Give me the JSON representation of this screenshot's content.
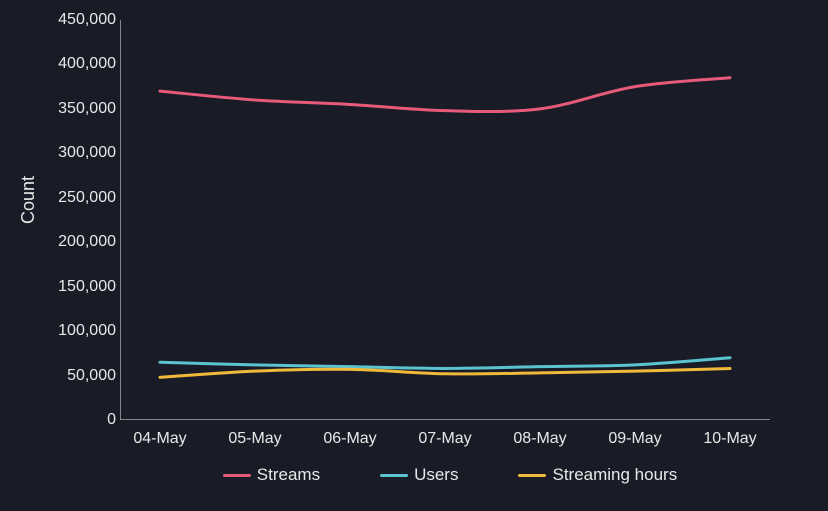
{
  "chart_data": {
    "type": "line",
    "ylabel": "Count",
    "xlabel": "",
    "ylim": [
      0,
      450000
    ],
    "yticks": [
      0,
      50000,
      100000,
      150000,
      200000,
      250000,
      300000,
      350000,
      400000,
      450000
    ],
    "ytick_labels": [
      "0",
      "50,000",
      "100,000",
      "150,000",
      "200,000",
      "250,000",
      "300,000",
      "350,000",
      "400,000",
      "450,000"
    ],
    "categories": [
      "04-May",
      "05-May",
      "06-May",
      "07-May",
      "08-May",
      "09-May",
      "10-May"
    ],
    "series": [
      {
        "name": "Streams",
        "color": "#e85a7a",
        "values": [
          370000,
          360000,
          355000,
          348000,
          350000,
          375000,
          385000
        ]
      },
      {
        "name": "Users",
        "color": "#5bc3cf",
        "values": [
          65000,
          62000,
          60000,
          58000,
          60000,
          62000,
          70000
        ]
      },
      {
        "name": "Streaming hours",
        "color": "#f0b93a",
        "values": [
          48000,
          55000,
          57000,
          52000,
          53000,
          55000,
          58000
        ]
      }
    ]
  }
}
